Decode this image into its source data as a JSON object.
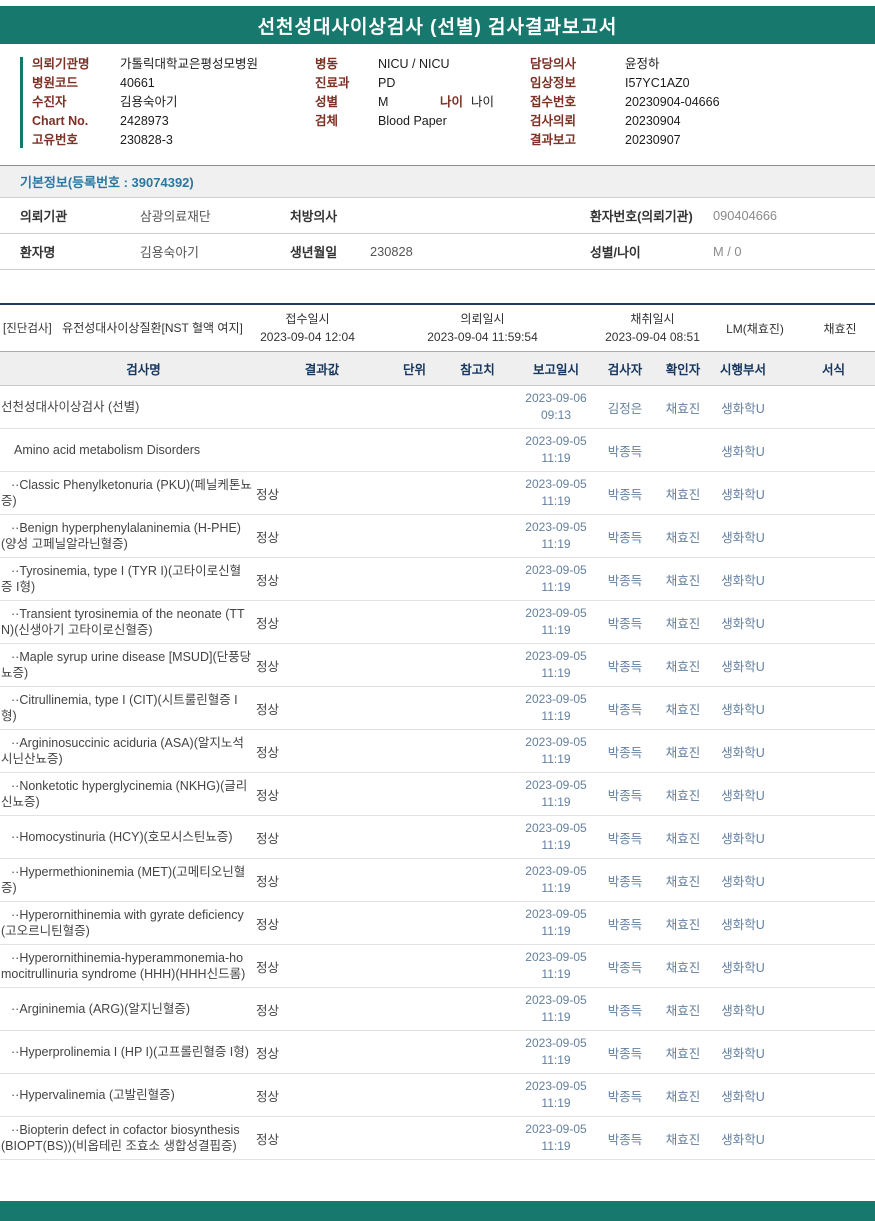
{
  "colors": {
    "teal_accent": "#17796d",
    "label_maroon": "#7d3125",
    "heading_blue": "#2878a0",
    "separator_navy": "#203a64",
    "table_header_navy": "#17365d",
    "muted_blue_text": "#64809e"
  },
  "title": "선천성대사이상검사 (선별) 검사결과보고서",
  "header_info": {
    "col1": [
      {
        "label": "의뢰기관명",
        "value": "가톨릭대학교은평성모병원"
      },
      {
        "label": "병원코드",
        "value": "40661"
      },
      {
        "label": "수진자",
        "value": "김용숙아기"
      },
      {
        "label": "Chart No.",
        "value": "2428973"
      },
      {
        "label": "고유번호",
        "value": "230828-3"
      }
    ],
    "col2": [
      {
        "label": "병동",
        "value": "NICU / NICU"
      },
      {
        "label": "진료과",
        "value": "PD"
      },
      {
        "label": "성별",
        "value": "M",
        "label2": "나이",
        "value2": "나이"
      },
      {
        "label": "검체",
        "value": "Blood Paper"
      }
    ],
    "col3": [
      {
        "label": "담당의사",
        "value": "윤정하"
      },
      {
        "label": "임상정보",
        "value": "I57YC1AZ0"
      },
      {
        "label": "접수번호",
        "value": "20230904-04666"
      },
      {
        "label": "검사의뢰",
        "value": "20230904"
      },
      {
        "label": "결과보고",
        "value": "20230907"
      }
    ]
  },
  "basic_info_heading": "기본정보(등록번호 : 39074392)",
  "patient_table": {
    "rows": [
      [
        {
          "label": "의뢰기관",
          "value": "삼광의료재단"
        },
        {
          "label": "처방의사",
          "value": ""
        },
        {
          "label": "환자번호(의뢰기관)",
          "value": "090404666"
        }
      ],
      [
        {
          "label": "환자명",
          "value": "김용숙아기"
        },
        {
          "label": "생년월일",
          "value": "230828"
        },
        {
          "label": "성별/나이",
          "value": "M / 0"
        }
      ]
    ]
  },
  "diagnostic": {
    "tag": "[진단검사]",
    "group": "유전성대사이상질환[NST 혈액 여지]",
    "receipt_label": "접수일시",
    "receipt_value": "2023-09-04 12:04",
    "request_label": "의뢰일시",
    "request_value": "2023-09-04 11:59:54",
    "collection_label": "채취일시",
    "collection_value": "2023-09-04 08:51",
    "lm": "LM(채효진)",
    "collector": "채효진"
  },
  "results_table": {
    "headers": [
      "검사명",
      "결과값",
      "단위",
      "참고치",
      "보고일시",
      "검사자",
      "확인자",
      "시행부서",
      "서식"
    ],
    "rows": [
      {
        "name": "선천성대사이상검사 (선별)",
        "indent": 0,
        "result": "",
        "date": "2023-09-06",
        "time": "09:13",
        "tester": "김정은",
        "confirmer": "채효진",
        "dept": "생화학U"
      },
      {
        "name": "Amino acid metabolism Disorders",
        "indent": 1,
        "result": "",
        "date": "2023-09-05",
        "time": "11:19",
        "tester": "박종득",
        "confirmer": "",
        "dept": "생화학U"
      },
      {
        "name": "··Classic Phenylketonuria (PKU)(페닐케톤뇨증)",
        "indent": 2,
        "result": "정상",
        "date": "2023-09-05",
        "time": "11:19",
        "tester": "박종득",
        "confirmer": "채효진",
        "dept": "생화학U"
      },
      {
        "name": "··Benign hyperphenylalaninemia (H-PHE)(양성 고페닐알라닌혈증)",
        "indent": 2,
        "result": "정상",
        "date": "2023-09-05",
        "time": "11:19",
        "tester": "박종득",
        "confirmer": "채효진",
        "dept": "생화학U"
      },
      {
        "name": "··Tyrosinemia, type I (TYR I)(고타이로신혈증 I형)",
        "indent": 2,
        "result": "정상",
        "date": "2023-09-05",
        "time": "11:19",
        "tester": "박종득",
        "confirmer": "채효진",
        "dept": "생화학U"
      },
      {
        "name": "··Transient tyrosinemia of the neonate (TTN)(신생아기 고타이로신혈증)",
        "indent": 2,
        "result": "정상",
        "date": "2023-09-05",
        "time": "11:19",
        "tester": "박종득",
        "confirmer": "채효진",
        "dept": "생화학U"
      },
      {
        "name": "··Maple syrup urine disease [MSUD](단풍당뇨증)",
        "indent": 2,
        "result": "정상",
        "date": "2023-09-05",
        "time": "11:19",
        "tester": "박종득",
        "confirmer": "채효진",
        "dept": "생화학U"
      },
      {
        "name": "··Citrullinemia, type I (CIT)(시트룰린혈증 I형)",
        "indent": 2,
        "result": "정상",
        "date": "2023-09-05",
        "time": "11:19",
        "tester": "박종득",
        "confirmer": "채효진",
        "dept": "생화학U"
      },
      {
        "name": "··Argininosuccinic aciduria (ASA)(알지노석시닌산뇨증)",
        "indent": 2,
        "result": "정상",
        "date": "2023-09-05",
        "time": "11:19",
        "tester": "박종득",
        "confirmer": "채효진",
        "dept": "생화학U"
      },
      {
        "name": "··Nonketotic hyperglycinemia (NKHG)(글리신뇨증)",
        "indent": 2,
        "result": "정상",
        "date": "2023-09-05",
        "time": "11:19",
        "tester": "박종득",
        "confirmer": "채효진",
        "dept": "생화학U"
      },
      {
        "name": "··Homocystinuria (HCY)(호모시스틴뇨증)",
        "indent": 2,
        "result": "정상",
        "date": "2023-09-05",
        "time": "11:19",
        "tester": "박종득",
        "confirmer": "채효진",
        "dept": "생화학U"
      },
      {
        "name": "··Hypermethioninemia (MET)(고메티오닌혈증)",
        "indent": 2,
        "result": "정상",
        "date": "2023-09-05",
        "time": "11:19",
        "tester": "박종득",
        "confirmer": "채효진",
        "dept": "생화학U"
      },
      {
        "name": "··Hyperornithinemia with gyrate deficiency(고오르니틴혈증)",
        "indent": 2,
        "result": "정상",
        "date": "2023-09-05",
        "time": "11:19",
        "tester": "박종득",
        "confirmer": "채효진",
        "dept": "생화학U"
      },
      {
        "name": "··Hyperornithinemia-hyperammonemia-homocitrullinuria syndrome (HHH)(HHH신드롬)",
        "indent": 2,
        "result": "정상",
        "date": "2023-09-05",
        "time": "11:19",
        "tester": "박종득",
        "confirmer": "채효진",
        "dept": "생화학U"
      },
      {
        "name": "··Argininemia (ARG)(알지닌혈증)",
        "indent": 2,
        "result": "정상",
        "date": "2023-09-05",
        "time": "11:19",
        "tester": "박종득",
        "confirmer": "채효진",
        "dept": "생화학U"
      },
      {
        "name": "··Hyperprolinemia I (HP I)(고프롤린혈증 I형)",
        "indent": 2,
        "result": "정상",
        "date": "2023-09-05",
        "time": "11:19",
        "tester": "박종득",
        "confirmer": "채효진",
        "dept": "생화학U"
      },
      {
        "name": "··Hypervalinemia (고발린혈증)",
        "indent": 2,
        "result": "정상",
        "date": "2023-09-05",
        "time": "11:19",
        "tester": "박종득",
        "confirmer": "채효진",
        "dept": "생화학U"
      },
      {
        "name": "··Biopterin defect in cofactor biosynthesis (BIOPT(BS))(비옵테린 조효소 생합성결핍증)",
        "indent": 2,
        "result": "정상",
        "date": "2023-09-05",
        "time": "11:19",
        "tester": "박종득",
        "confirmer": "채효진",
        "dept": "생화학U"
      }
    ]
  }
}
